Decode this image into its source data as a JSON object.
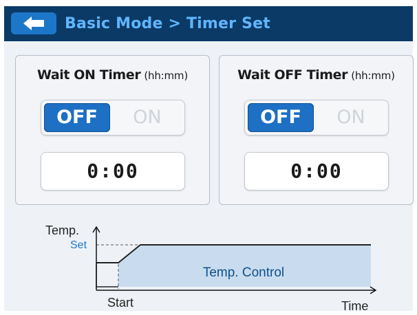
{
  "header": {
    "title": "Basic Mode > Timer Set"
  },
  "panels": [
    {
      "title": "Wait ON Timer",
      "unit": "(hh:mm)",
      "toggle_off": "OFF",
      "toggle_on": "ON",
      "selected": "OFF",
      "time": "0:00"
    },
    {
      "title": "Wait OFF Timer",
      "unit": "(hh:mm)",
      "toggle_off": "OFF",
      "toggle_on": "ON",
      "selected": "OFF",
      "time": "0:00"
    }
  ],
  "diagram": {
    "y_axis_label": "Temp.",
    "set_label": "Set",
    "region_label": "Temp. Control",
    "start_label": "Start",
    "x_axis_label": "Time"
  },
  "colors": {
    "header_bg": "#0b3a66",
    "title_text": "#5fb6ff",
    "accent_blue": "#1d70c4",
    "region_fill": "#c9dcef",
    "set_label": "#1d77c9"
  }
}
